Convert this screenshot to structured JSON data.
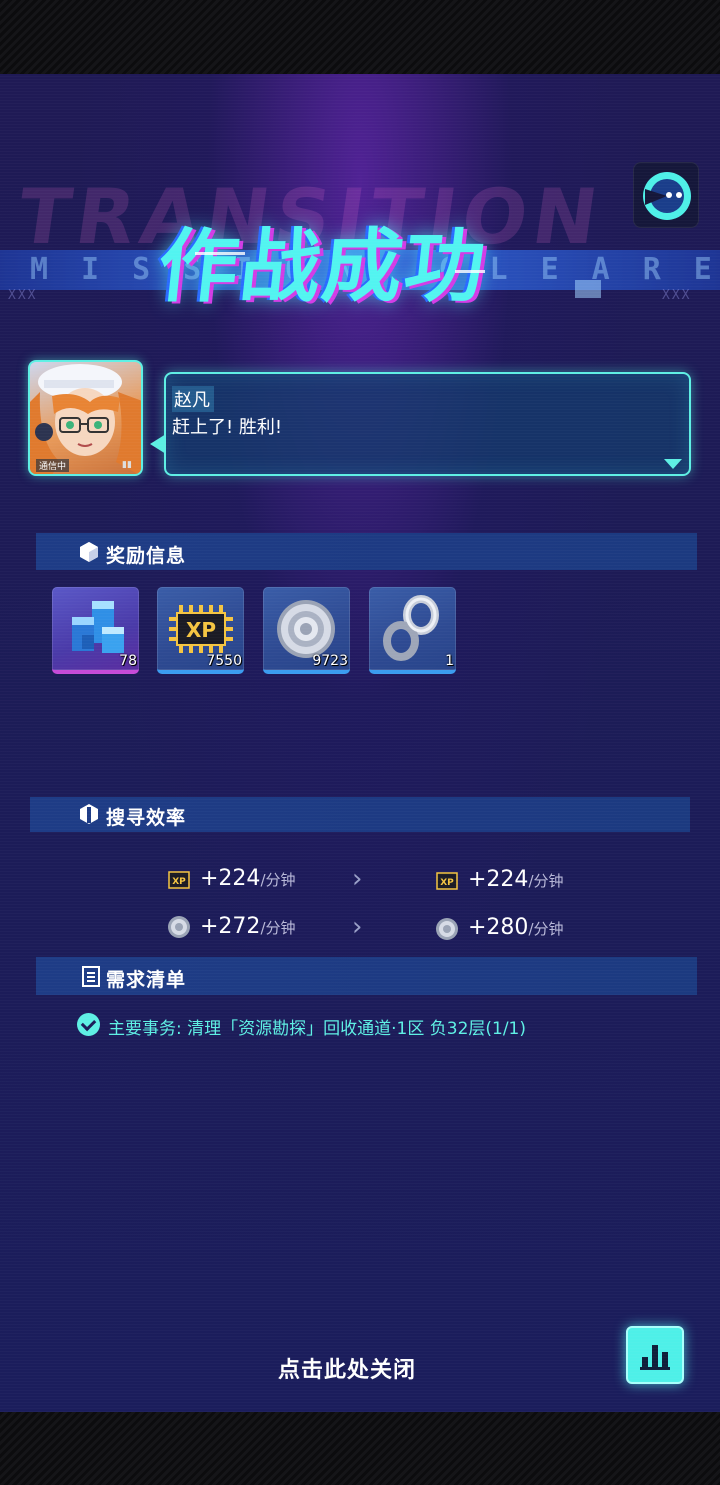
{
  "banner": {
    "title": "作战成功",
    "bg_text": "TRANSITION",
    "sub_text": "MISSION CLEARED",
    "xxx_left": "XXX",
    "xxx_right": "XXX"
  },
  "dialog": {
    "avatar_label": "通信中",
    "avatar_signal": "▮▮",
    "speaker": "赵凡",
    "line": "赶上了!  胜利!"
  },
  "rewards": {
    "header": "奖励信息",
    "items": [
      {
        "icon": "blue-cubes-icon",
        "count": "78"
      },
      {
        "icon": "xp-chip-icon",
        "count": "7550"
      },
      {
        "icon": "silver-coin-icon",
        "count": "9723"
      },
      {
        "icon": "infinity-link-icon",
        "count": "1"
      }
    ]
  },
  "efficiency": {
    "header": "搜寻效率",
    "xp_before": "+224",
    "xp_after": "+224",
    "coin_before": "+272",
    "coin_after": "+280",
    "unit": "/分钟",
    "arrow": "›"
  },
  "requirements": {
    "header": "需求清单",
    "quest": "主要事务:  清理「资源勘探」回收通道·1区 负32层(1/1)"
  },
  "footer": {
    "close_text": "点击此处关闭"
  },
  "colors": {
    "accent_cyan": "#5ef0e4",
    "magenta": "#d23ce6",
    "section_bg": "#1e3c86",
    "screen_bg": "#1c1c58"
  }
}
